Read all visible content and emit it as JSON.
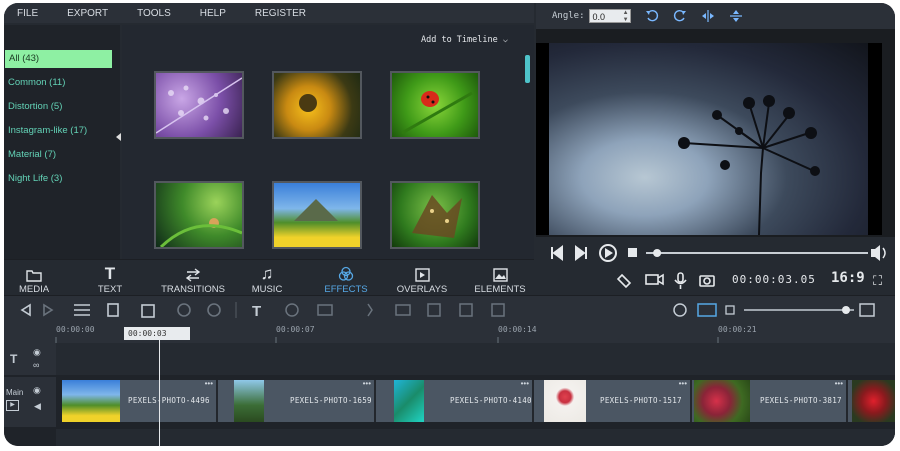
{
  "menu": [
    "FILE",
    "EXPORT",
    "TOOLS",
    "HELP",
    "REGISTER"
  ],
  "preview_toolbar": {
    "angle_label": "Angle:",
    "angle_value": "0.0"
  },
  "categories": [
    {
      "label": "All (43)",
      "active": true
    },
    {
      "label": "Common (11)"
    },
    {
      "label": "Distortion (5)"
    },
    {
      "label": "Instagram-like (17)"
    },
    {
      "label": "Material (7)"
    },
    {
      "label": "Night Life (3)"
    }
  ],
  "add_to_timeline": "Add to Timeline",
  "tabs": [
    {
      "label": "MEDIA",
      "icon": "folder-icon"
    },
    {
      "label": "TEXT",
      "icon": "text-icon"
    },
    {
      "label": "TRANSITIONS",
      "icon": "transitions-icon"
    },
    {
      "label": "MUSIC",
      "icon": "music-icon"
    },
    {
      "label": "EFFECTS",
      "icon": "effects-icon",
      "active": true
    },
    {
      "label": "OVERLAYS",
      "icon": "overlays-icon"
    },
    {
      "label": "ELEMENTS",
      "icon": "elements-icon"
    }
  ],
  "player": {
    "timecode": "00:00:03.05",
    "aspect": "16:9",
    "progress": 0.05
  },
  "ruler": [
    "00:00:00",
    "00:00:07",
    "00:00:14",
    "00:00:21"
  ],
  "playhead": "00:00:03",
  "tracks": {
    "main_label": "Main"
  },
  "clips": [
    "PEXELS-PHOTO-4496",
    "PEXELS-PHOTO-1659",
    "PEXELS-PHOTO-4140",
    "PEXELS-PHOTO-1517",
    "PEXELS-PHOTO-3817"
  ],
  "colors": {
    "accent": "#56a8e6",
    "category_active": "#8ef0a3",
    "category_text": "#63d2b6"
  }
}
